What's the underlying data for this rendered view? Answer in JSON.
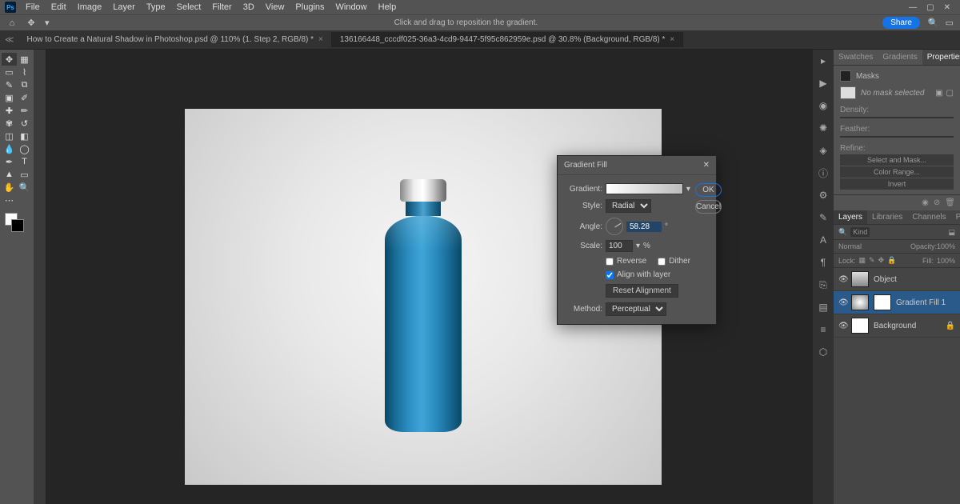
{
  "menu": {
    "items": [
      "File",
      "Edit",
      "Image",
      "Layer",
      "Type",
      "Select",
      "Filter",
      "3D",
      "View",
      "Plugins",
      "Window",
      "Help"
    ]
  },
  "optbar": {
    "hint": "Click and drag to reposition the gradient.",
    "share": "Share"
  },
  "tabs": [
    {
      "label": "How to Create a Natural Shadow in Photoshop.psd @ 110% (1. Step 2, RGB/8) *"
    },
    {
      "label": "136166448_cccdf025-36a3-4cd9-9447-5f95c862959e.psd @ 30.8% (Background, RGB/8) *"
    }
  ],
  "dialog": {
    "title": "Gradient Fill",
    "gradient_label": "Gradient:",
    "style_label": "Style:",
    "style_value": "Radial",
    "angle_label": "Angle:",
    "angle_value": "58.28",
    "scale_label": "Scale:",
    "scale_value": "100",
    "scale_unit": "%",
    "reverse": "Reverse",
    "dither": "Dither",
    "align": "Align with layer",
    "reset": "Reset Alignment",
    "method_label": "Method:",
    "method_value": "Perceptual",
    "ok": "OK",
    "cancel": "Cancel"
  },
  "properties": {
    "tabs": [
      "Swatches",
      "Gradients",
      "Properties"
    ],
    "masks_title": "Masks",
    "no_mask": "No mask selected",
    "density": "Density:",
    "feather": "Feather:",
    "refine": "Refine:",
    "select_mask": "Select and Mask...",
    "color_range": "Color Range...",
    "invert": "Invert"
  },
  "layers": {
    "tabs": [
      "Layers",
      "Libraries",
      "Channels",
      "Paths"
    ],
    "kind": "Kind",
    "mode": "Normal",
    "opacity_label": "Opacity:",
    "opacity": "100%",
    "lock_label": "Lock:",
    "fill_label": "Fill:",
    "fill": "100%",
    "items": [
      {
        "name": "Object"
      },
      {
        "name": "Gradient Fill 1"
      },
      {
        "name": "Background"
      }
    ]
  }
}
